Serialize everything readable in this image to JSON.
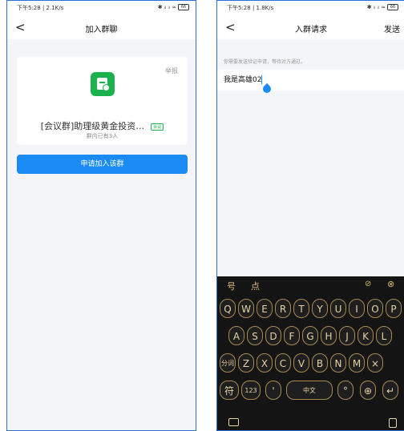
{
  "left": {
    "status": {
      "time_speed": "下午5:28 | 2.1K/s",
      "indicators": "✈ 0 ⊡",
      "signal": "✱ ᵢₗ ᵢₗ ≈",
      "battery": "66"
    },
    "nav": {
      "back": "<",
      "title": "加入群聊"
    },
    "card": {
      "report": "举报",
      "group_name": "[会议群]助理级黄金投资…",
      "tag": "会议",
      "member_count": "群内已有3人"
    },
    "join_button": "申请加入该群"
  },
  "right": {
    "status": {
      "time_speed": "下午5:28 | 1.8K/s",
      "indicators": "✈ 0 ⊡",
      "signal": "✱ ᵢₗ ᵢₗ ≈",
      "battery": "66"
    },
    "nav": {
      "back": "<",
      "title": "入群请求",
      "send": "发送"
    },
    "hint": "你需要发送验证申请，等待对方通过。",
    "input_value": "我是高雄02",
    "keyboard": {
      "candidates": [
        "号",
        "点"
      ],
      "row1": [
        "Q",
        "W",
        "E",
        "R",
        "T",
        "Y",
        "U",
        "I",
        "O",
        "P"
      ],
      "row2": [
        "A",
        "S",
        "D",
        "F",
        "G",
        "H",
        "J",
        "K",
        "L"
      ],
      "row3": [
        "分词",
        "Z",
        "X",
        "C",
        "V",
        "B",
        "N",
        "M",
        "×"
      ],
      "row4": [
        "符",
        "123",
        "'",
        "中文",
        "°",
        "⊕",
        "↵"
      ]
    }
  },
  "colors": {
    "accent": "#1a8bf5",
    "group_icon": "#1bb24e",
    "keyboard_bg": "#141414",
    "key_text": "#e6d2a4"
  }
}
